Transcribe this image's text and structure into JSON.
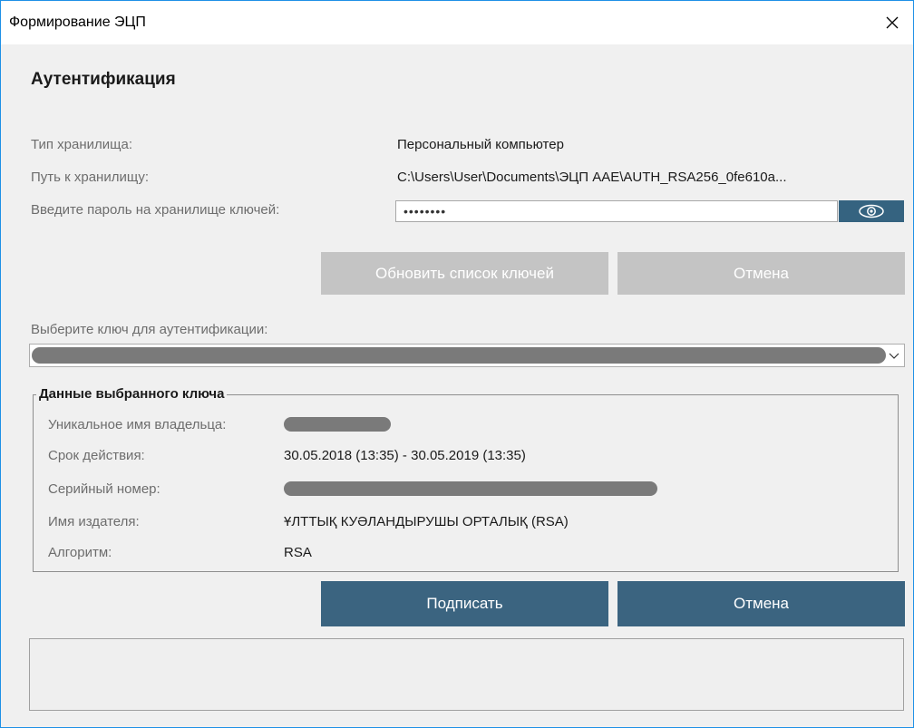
{
  "window": {
    "title": "Формирование ЭЦП"
  },
  "heading": "Аутентификация",
  "storage": {
    "type_label": "Тип хранилища:",
    "type_value": "Персональный компьютер",
    "path_label": "Путь к хранилищу:",
    "path_value": "C:\\Users\\User\\Documents\\ЭЦП AAE\\AUTH_RSA256_0fe610a...",
    "password_label": "Введите пароль на хранилище ключей:",
    "password_value": "••••••••"
  },
  "buttons": {
    "refresh_label": "Обновить список ключей",
    "cancel_top_label": "Отмена",
    "sign_label": "Подписать",
    "cancel_bottom_label": "Отмена"
  },
  "key_select": {
    "label": "Выберите ключ для аутентификации:"
  },
  "key_details": {
    "legend": "Данные выбранного ключа",
    "owner_label": "Уникальное имя владельца:",
    "validity_label": "Срок действия:",
    "validity_value": "30.05.2018 (13:35) - 30.05.2019 (13:35)",
    "serial_label": "Серийный номер:",
    "issuer_label": "Имя издателя:",
    "issuer_value": "ҰЛТТЫҚ КУӘЛАНДЫРУШЫ ОРТАЛЫҚ (RSA)",
    "algorithm_label": "Алгоритм:",
    "algorithm_value": "RSA"
  },
  "icons": {
    "close": "close-icon",
    "eye": "eye-icon",
    "dropdown": "chevron-down-icon"
  },
  "colors": {
    "primary": "#3b6480",
    "disabled": "#c4c4c4",
    "window_border": "#1e90e6"
  }
}
